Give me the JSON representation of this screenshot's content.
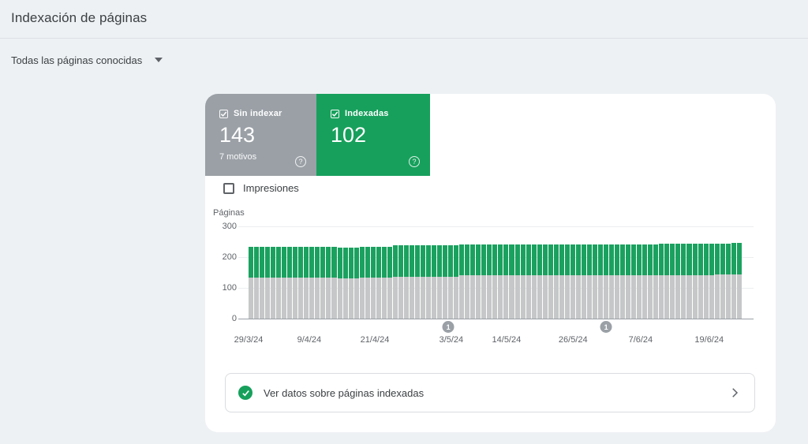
{
  "page": {
    "title": "Indexación de páginas"
  },
  "filter": {
    "label": "Todas las páginas conocidas"
  },
  "tiles": [
    {
      "label": "Sin indexar",
      "value": "143",
      "sub": "7 motivos",
      "color": "#9aa0a6",
      "checked": true
    },
    {
      "label": "Indexadas",
      "value": "102",
      "sub": "",
      "color": "#17a05c",
      "checked": true
    }
  ],
  "impressions_toggle": {
    "label": "Impresiones",
    "checked": false
  },
  "chart_data": {
    "type": "bar",
    "stacked": true,
    "title": "",
    "ylabel": "Páginas",
    "xlabel": "",
    "ylim": [
      0,
      300
    ],
    "yticks": [
      0,
      100,
      200,
      300
    ],
    "grid": true,
    "xtick_labels": [
      "29/3/24",
      "9/4/24",
      "21/4/24",
      "3/5/24",
      "14/5/24",
      "26/5/24",
      "7/6/24",
      "19/6/24"
    ],
    "xtick_positions_pct": [
      0,
      12.3,
      25.6,
      41.1,
      52.3,
      65.8,
      79.5,
      93.4
    ],
    "colors": {
      "indexed": "#1ba15f",
      "not_indexed": "#c5c7c8"
    },
    "series": [
      {
        "name": "Sin indexar",
        "values": [
          133,
          133,
          133,
          133,
          133,
          133,
          133,
          133,
          133,
          133,
          133,
          133,
          133,
          133,
          133,
          133,
          132,
          132,
          132,
          132,
          134,
          134,
          134,
          134,
          134,
          134,
          135,
          135,
          135,
          135,
          135,
          135,
          135,
          135,
          135,
          135,
          135,
          135,
          140,
          140,
          140,
          140,
          140,
          140,
          140,
          140,
          140,
          140,
          140,
          140,
          140,
          140,
          140,
          140,
          140,
          140,
          140,
          140,
          140,
          141,
          141,
          141,
          141,
          141,
          141,
          141,
          141,
          141,
          141,
          141,
          141,
          141,
          141,
          141,
          142,
          142,
          142,
          142,
          142,
          142,
          142,
          142,
          142,
          142,
          143,
          143,
          143,
          143,
          143
        ]
      },
      {
        "name": "Indexadas",
        "values": [
          100,
          100,
          100,
          100,
          100,
          100,
          100,
          100,
          100,
          100,
          100,
          100,
          100,
          100,
          100,
          100,
          100,
          100,
          100,
          100,
          100,
          100,
          100,
          100,
          100,
          100,
          103,
          103,
          103,
          103,
          103,
          103,
          103,
          103,
          103,
          103,
          103,
          103,
          100,
          100,
          100,
          100,
          100,
          100,
          100,
          100,
          100,
          100,
          100,
          100,
          100,
          100,
          100,
          100,
          100,
          100,
          100,
          100,
          100,
          101,
          101,
          101,
          101,
          101,
          101,
          101,
          101,
          101,
          101,
          101,
          101,
          101,
          101,
          101,
          101,
          101,
          101,
          101,
          101,
          101,
          101,
          101,
          101,
          101,
          100,
          100,
          100,
          102,
          102
        ]
      }
    ],
    "annotations": [
      {
        "label": "1",
        "position_pct": 40.5
      },
      {
        "label": "1",
        "position_pct": 72.5
      }
    ]
  },
  "footer_link": {
    "label": "Ver datos sobre páginas indexadas"
  }
}
